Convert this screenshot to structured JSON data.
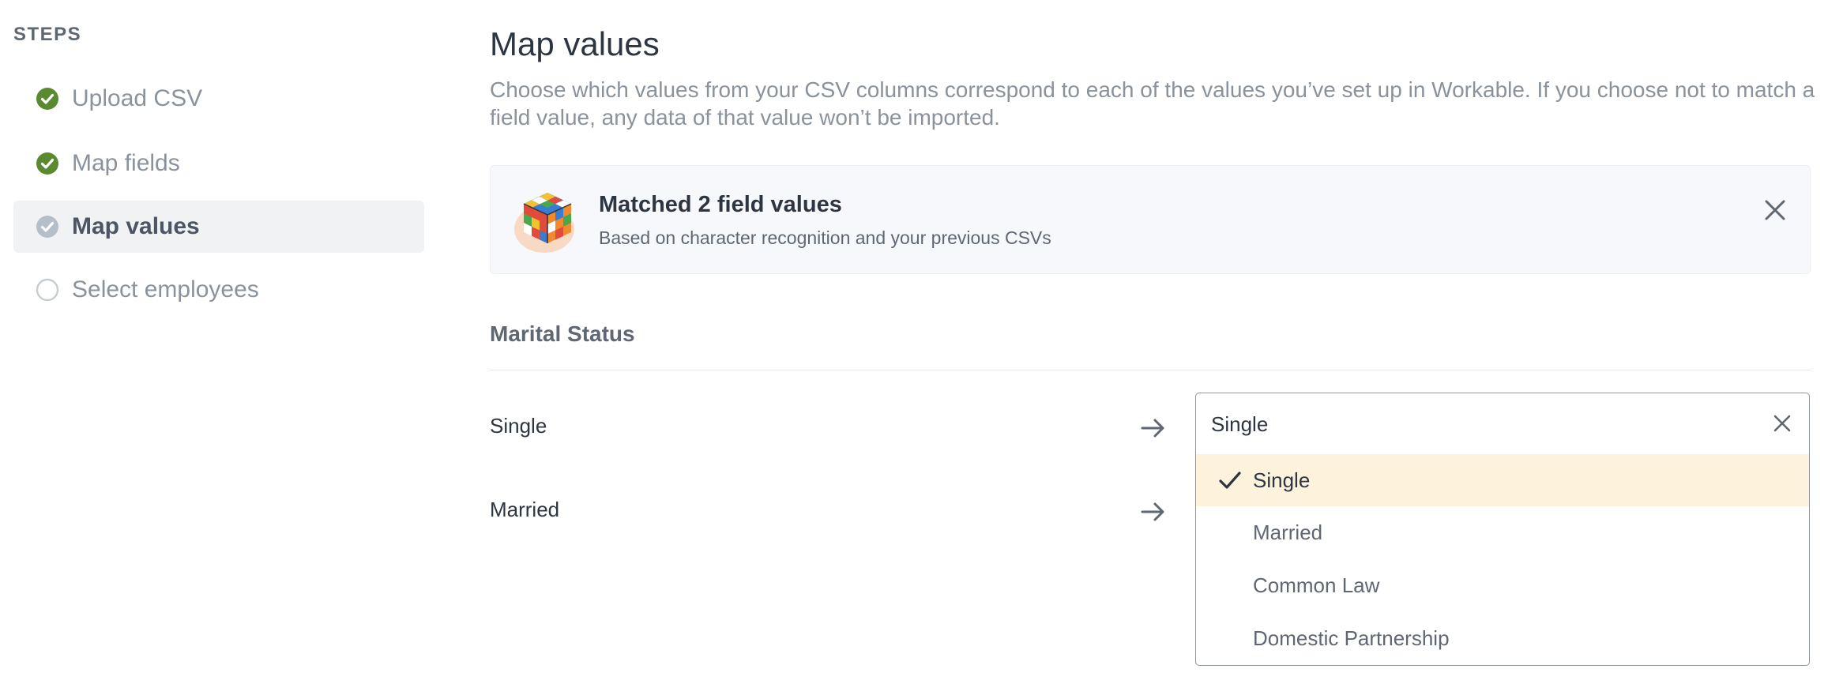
{
  "sidebar": {
    "heading": "STEPS",
    "steps": [
      {
        "label": "Upload CSV",
        "status": "complete"
      },
      {
        "label": "Map fields",
        "status": "complete"
      },
      {
        "label": "Map values",
        "status": "current"
      },
      {
        "label": "Select employees",
        "status": "pending"
      }
    ]
  },
  "main": {
    "title": "Map values",
    "description": "Choose which values from your CSV columns correspond to each of the values you’ve set up in Workable. If you choose not to match a field value, any data of that value won’t be imported.",
    "banner": {
      "title": "Matched 2 field values",
      "subtitle": "Based on character recognition and your previous CSVs"
    },
    "section_title": "Marital Status",
    "rows": [
      {
        "source": "Single"
      },
      {
        "source": "Married"
      }
    ],
    "dropdown": {
      "value": "Single",
      "options": [
        "Single",
        "Married",
        "Common Law",
        "Domestic Partnership"
      ],
      "selected_index": 0
    }
  },
  "colors": {
    "complete_green": "#5a8a2f",
    "current_grey": "#b4bfc9",
    "pending_grey": "#c4ccd5",
    "selected_option_bg": "#fdf3dd",
    "active_step_bg": "#f1f2f4"
  },
  "icons": {
    "complete": "check-circle-icon",
    "current": "check-circle-icon",
    "pending": "empty-circle-icon",
    "banner_close": "close-icon",
    "arrow": "arrow-right-icon",
    "clear": "close-icon",
    "selected": "check-icon"
  }
}
